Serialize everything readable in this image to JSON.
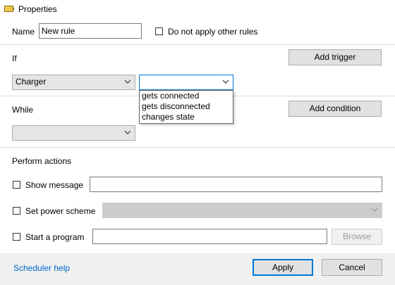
{
  "window": {
    "title": "Properties",
    "icon": "battery-icon"
  },
  "name_field": {
    "label": "Name",
    "value": "New rule"
  },
  "no_other_rules": {
    "label": "Do not apply other rules",
    "checked": false
  },
  "if_section": {
    "label": "If",
    "add_trigger_label": "Add trigger",
    "trigger_combo_value": "Charger",
    "event_combo_value": "",
    "event_options": [
      "gets connected",
      "gets disconnected",
      "changes state"
    ]
  },
  "while_section": {
    "label": "While",
    "add_condition_label": "Add condition",
    "condition_combo_value": ""
  },
  "actions_section": {
    "label": "Perform actions",
    "show_message": {
      "label": "Show message",
      "checked": false,
      "value": ""
    },
    "power_scheme": {
      "label": "Set power scheme",
      "checked": false,
      "value": ""
    },
    "start_program": {
      "label": "Start a program",
      "checked": false,
      "value": "",
      "browse_label": "Browse"
    }
  },
  "footer": {
    "help_link": "Scheduler help",
    "apply_label": "Apply",
    "cancel_label": "Cancel"
  },
  "colors": {
    "accent": "#0078d7",
    "link": "#0066cc"
  }
}
